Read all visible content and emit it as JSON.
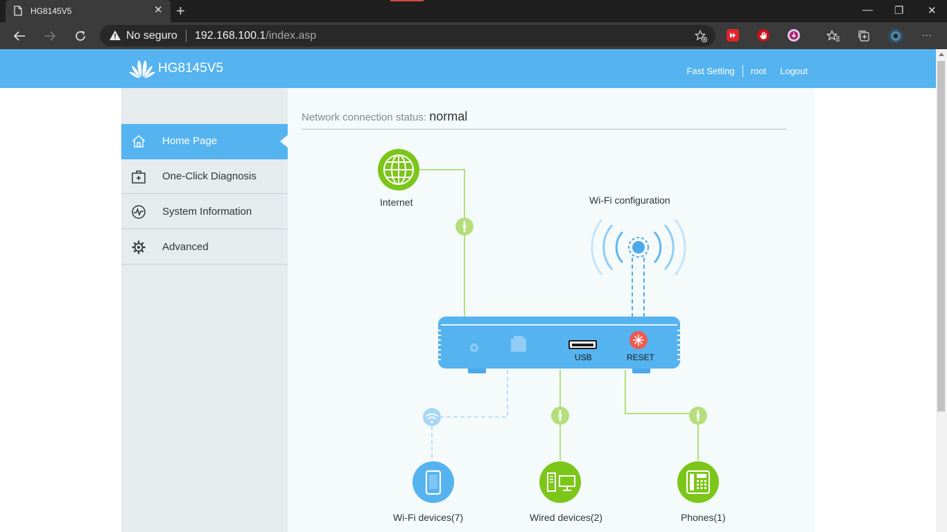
{
  "browser": {
    "tab_title": "HG8145V5",
    "tab_close": "✕",
    "new_tab": "+",
    "security_label": "No seguro",
    "url_host": "192.168.100.1",
    "url_path": "/index.asp",
    "window_controls": {
      "minimize": "—",
      "restore": "❐",
      "close": "✕"
    },
    "more_menu": "···"
  },
  "header": {
    "brand": "HG8145V5",
    "links": [
      "Fast Setting",
      "root",
      "Logout"
    ],
    "color": "#55b3f0"
  },
  "sidebar": {
    "items": [
      {
        "label": "Home Page",
        "icon": "home-icon",
        "active": true
      },
      {
        "label": "One-Click Diagnosis",
        "icon": "medical-kit-icon",
        "active": false
      },
      {
        "label": "System Information",
        "icon": "pulse-icon",
        "active": false
      },
      {
        "label": "Advanced",
        "icon": "gear-icon",
        "active": false
      }
    ]
  },
  "main": {
    "status_label": "Network connection status:",
    "status_value": "normal",
    "diagram": {
      "internet_label": "Internet",
      "wifi_config_label": "Wi-Fi configuration",
      "usb_label": "USB",
      "reset_label": "RESET",
      "wifi_devices_label": "Wi-Fi devices(7)",
      "wired_devices_label": "Wired devices(2)",
      "phones_label": "Phones(1)"
    }
  },
  "colors": {
    "accent_blue": "#55b3f0",
    "green": "#7cc61a",
    "link_green": "#b5df7a",
    "reset_red": "#ef5a4e"
  }
}
